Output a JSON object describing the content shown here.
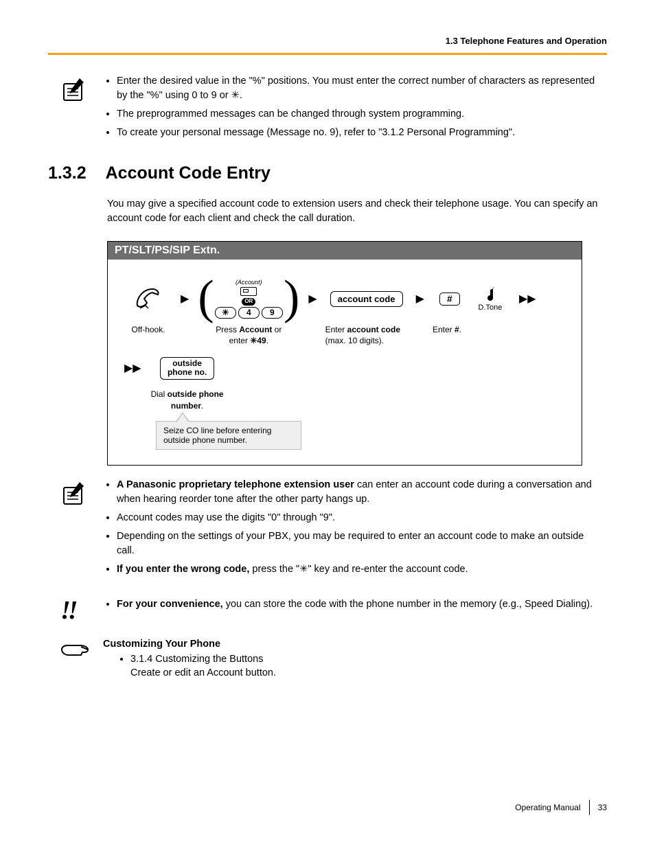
{
  "header": {
    "section_path": "1.3 Telephone Features and Operation"
  },
  "notes_top": {
    "items": [
      "Enter the desired value in the \"%\" positions. You must enter the correct number of characters as represented by the \"%\" using 0 to 9 or ✳.",
      "The preprogrammed messages can be changed through system programming.",
      "To create your personal message (Message no. 9), refer to \"3.1.2 Personal Programming\"."
    ]
  },
  "section": {
    "number": "1.3.2",
    "title": "Account Code Entry"
  },
  "intro": "You may give a specified account code to extension users and check their telephone usage. You can specify an account code for each client and check the call duration.",
  "procedure": {
    "title": "PT/SLT/PS/SIP Extn.",
    "step1": {
      "caption": "Off-hook."
    },
    "step2": {
      "account_label": "(Account)",
      "or_label": "OR",
      "keys": [
        "✳",
        "4",
        "9"
      ],
      "caption_prefix": "Press ",
      "caption_bold1": "Account",
      "caption_mid": " or enter ",
      "caption_bold2": "✳49",
      "caption_suffix": "."
    },
    "step3": {
      "box": "account code",
      "caption_prefix": "Enter ",
      "caption_bold": "account code",
      "caption_line2": "(max. 10 digits)."
    },
    "step4": {
      "key": "#",
      "caption_prefix": "Enter ",
      "caption_bold": "#",
      "caption_suffix": "."
    },
    "step5": {
      "label": "D.Tone"
    },
    "step6": {
      "box_line1": "outside",
      "box_line2": "phone no.",
      "caption_prefix": "Dial ",
      "caption_bold": "outside phone number",
      "caption_suffix": ".",
      "callout": "Seize CO line before entering outside phone number."
    }
  },
  "notes_bottom": {
    "items": [
      {
        "bold": "A Panasonic proprietary telephone extension user",
        "rest": " can enter an account code during a conversation and when hearing reorder tone after the other party hangs up."
      },
      {
        "bold": "",
        "rest": "Account codes may use the digits \"0\" through \"9\"."
      },
      {
        "bold": "",
        "rest": "Depending on the settings of your PBX, you may be required to enter an account code to make an outside call."
      },
      {
        "bold": "If you enter the wrong code,",
        "rest": " press the \"✳\" key and re-enter the account code."
      }
    ]
  },
  "tip": {
    "bold": "For your convenience,",
    "rest": " you can store the code with the phone number in the memory (e.g., Speed Dialing)."
  },
  "customize": {
    "heading": "Customizing Your Phone",
    "line1": "3.1.4 Customizing the Buttons",
    "line2": "Create or edit an Account button."
  },
  "footer": {
    "doc": "Operating Manual",
    "page": "33"
  }
}
